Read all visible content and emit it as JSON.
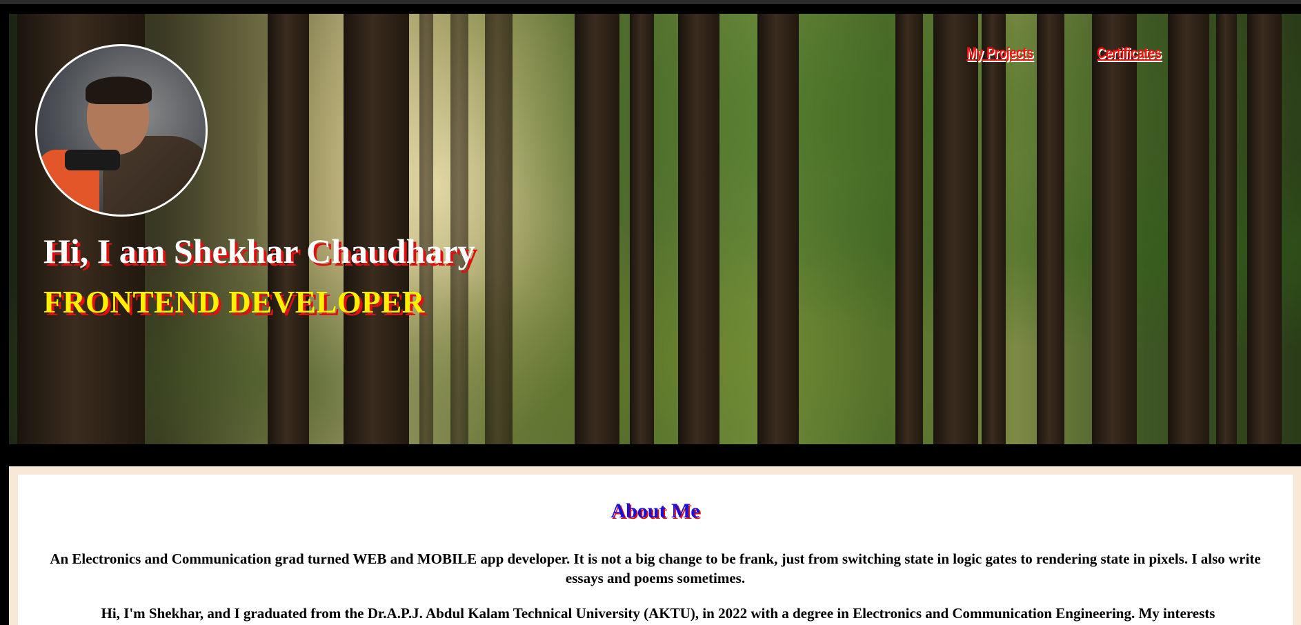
{
  "hero": {
    "nav": {
      "projects_label": "My Projects",
      "certificates_label": "Certificates"
    },
    "title": "Hi, I am Shekhar Chaudhary",
    "role": "FRONTEND DEVELOPER"
  },
  "about": {
    "title": "About Me",
    "paragraph1": "An Electronics and Communication grad turned WEB and MOBILE app developer. It is not a big change to be frank, just from switching state in logic gates to rendering state in pixels. I also write essays and poems sometimes.",
    "paragraph2": "Hi, I'm Shekhar, and I graduated from the Dr.A.P.J. Abdul Kalam Technical University (AKTU), in 2022 with a degree in Electronics and Communication Engineering. My interests"
  },
  "colors": {
    "nav_link": "#ff1010",
    "title_shadow": "#e01010",
    "role_text": "#fff000",
    "about_title": "#1a10d8",
    "about_frame": "#f8e8d8"
  },
  "icons": {
    "avatar": "profile-photo"
  }
}
